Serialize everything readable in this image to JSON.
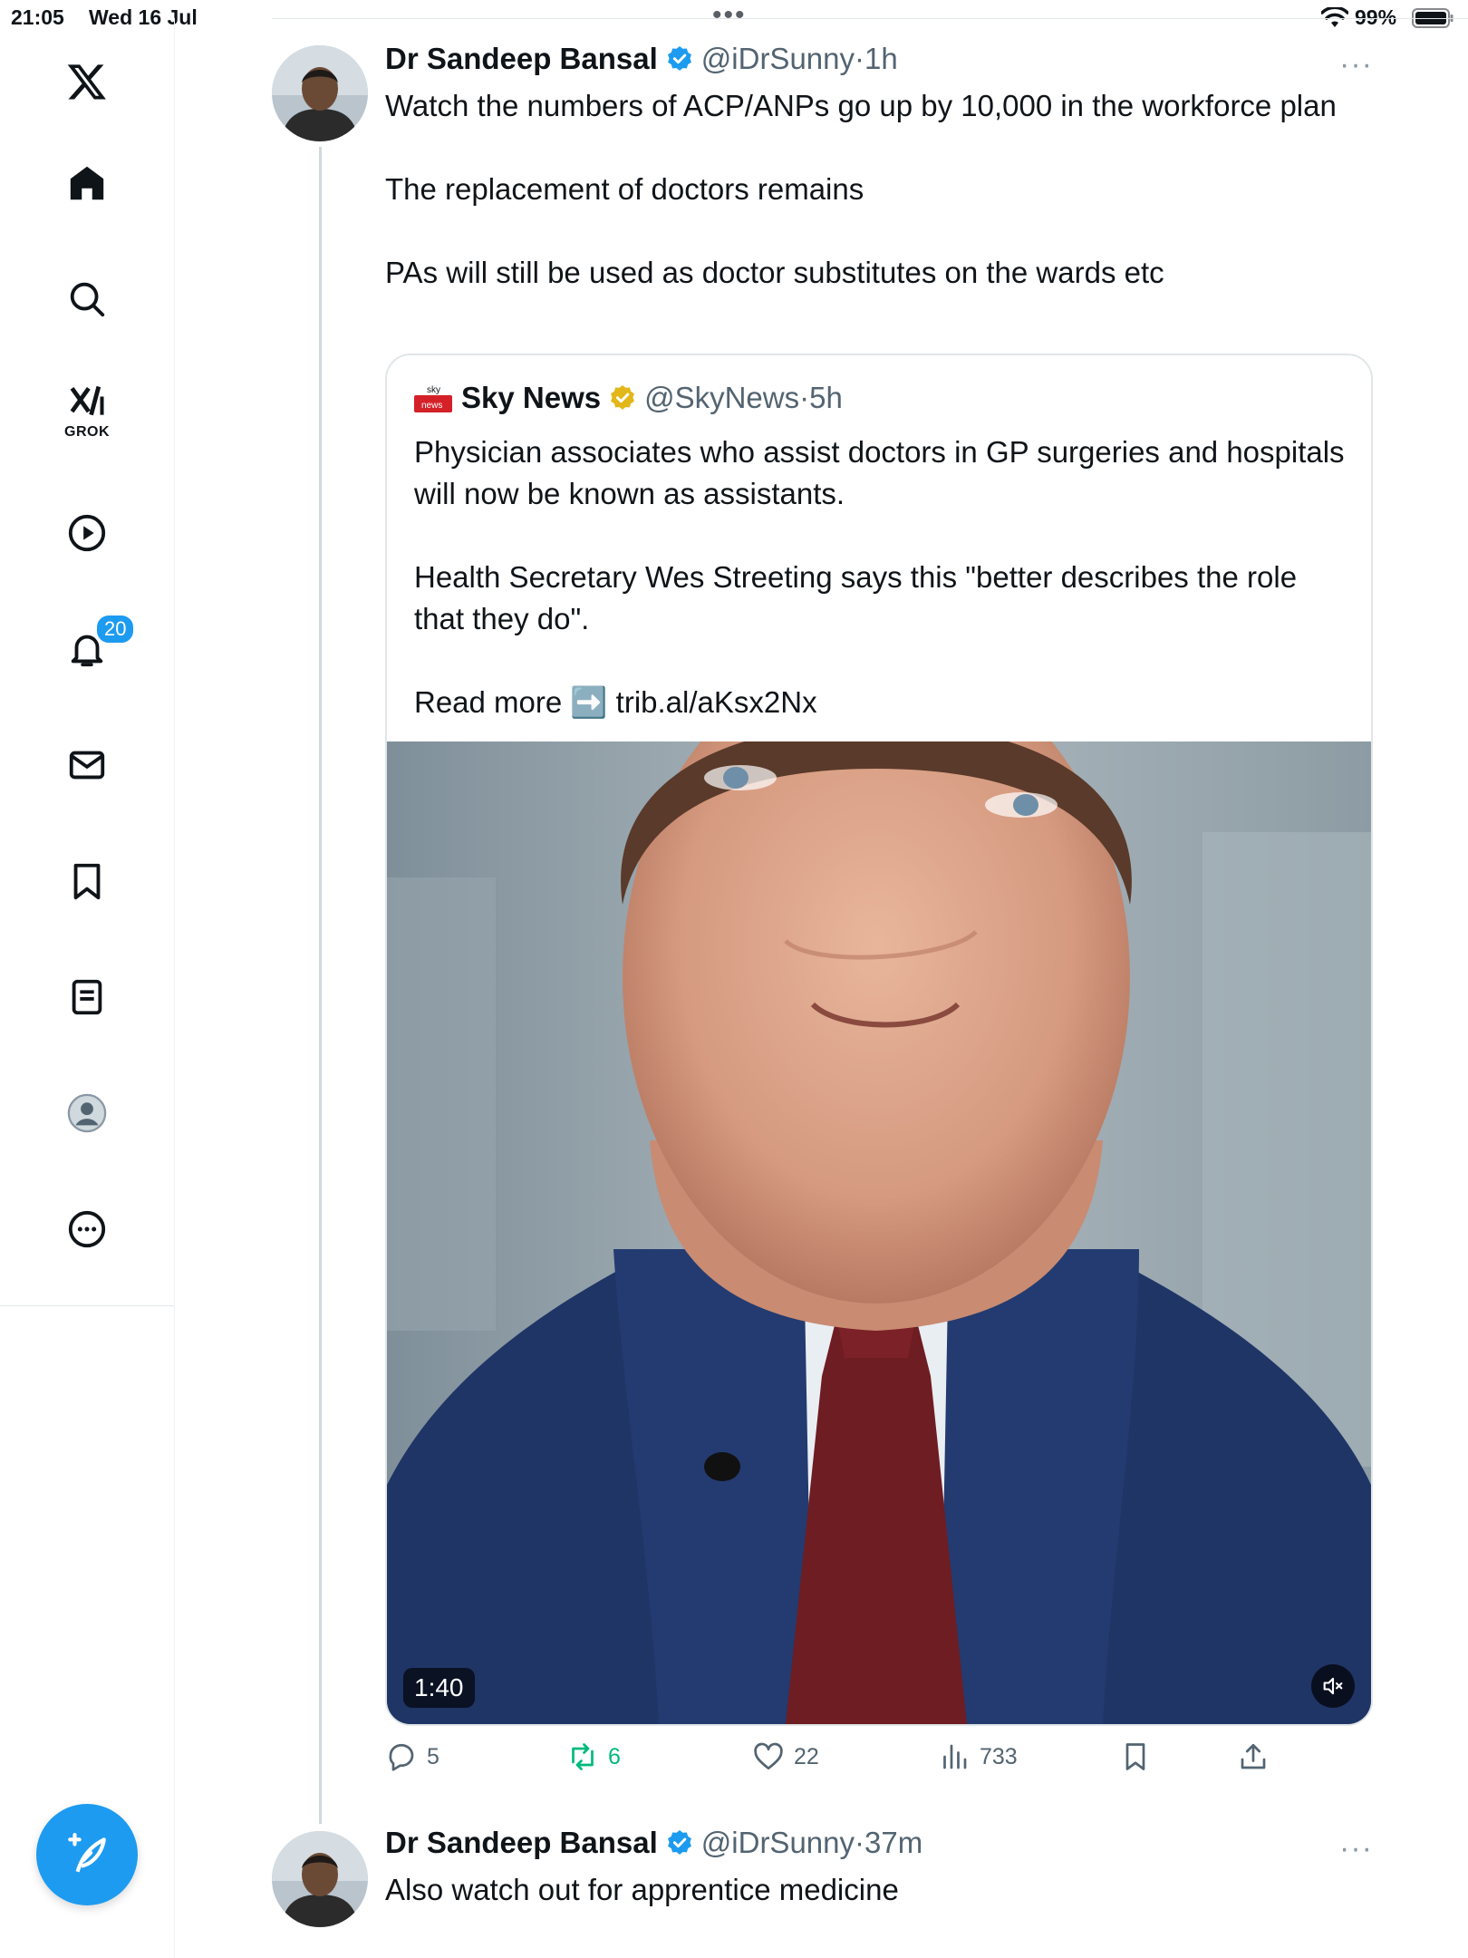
{
  "status_bar": {
    "time": "21:05",
    "date": "Wed 16 Jul",
    "battery": "99%"
  },
  "sidebar": {
    "items": [
      {
        "name": "x-logo",
        "label": ""
      },
      {
        "name": "home",
        "label": ""
      },
      {
        "name": "search",
        "label": ""
      },
      {
        "name": "grok",
        "label": "GROK"
      },
      {
        "name": "video",
        "label": ""
      },
      {
        "name": "notifications",
        "label": "",
        "badge": "20"
      },
      {
        "name": "messages",
        "label": ""
      },
      {
        "name": "bookmarks",
        "label": ""
      },
      {
        "name": "lists",
        "label": ""
      },
      {
        "name": "profile",
        "label": ""
      },
      {
        "name": "more",
        "label": ""
      }
    ],
    "accent_color": "#1d9bf0"
  },
  "tweets": [
    {
      "author": "Dr Sandeep Bansal",
      "handle": "@iDrSunny",
      "sep": "·",
      "time": "1h",
      "text": [
        "Watch the numbers of ACP/ANPs go up by 10,000 in the workforce plan",
        "The replacement of doctors remains",
        "PAs will still be used as doctor substitutes on the wards etc"
      ],
      "quote": {
        "author": "Sky News",
        "handle": "@SkyNews",
        "sep": "·",
        "time": "5h",
        "text": [
          "Physician associates who assist doctors in GP surgeries and hospitals will now be known as assistants.",
          "Health Secretary Wes Streeting says this \"better describes the role that they do\".",
          "Read more ➡️ trib.al/aKsx2Nx"
        ],
        "video_duration": "1:40"
      },
      "actions": {
        "replies": "5",
        "retweets": "6",
        "likes": "22",
        "views": "733"
      }
    },
    {
      "author": "Dr Sandeep Bansal",
      "handle": "@iDrSunny",
      "sep": "·",
      "time": "37m",
      "text": [
        "Also watch out for apprentice medicine"
      ]
    }
  ],
  "colors": {
    "verified_blue": "#1d9bf0",
    "verified_gold": "#e2b719",
    "retweet_green": "#00ba7c",
    "secondary_text": "#536471"
  }
}
